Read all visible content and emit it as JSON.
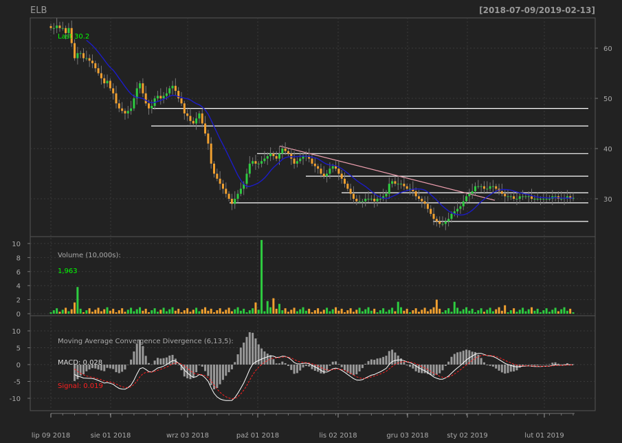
{
  "header": {
    "symbol": "ELB",
    "date_range": "[2018-07-09/2019-02-13]"
  },
  "price_panel": {
    "last_label": "Last 30.2",
    "y_ticks": [
      30,
      40,
      50,
      60
    ]
  },
  "volume_panel": {
    "title": "Volume (10,000s):",
    "value": "1,963",
    "y_ticks": [
      0,
      2,
      4,
      6,
      8,
      10
    ]
  },
  "macd_panel": {
    "title": "Moving Average Convergence Divergence (6,13,5):",
    "macd_label": "MACD: 0.028",
    "signal_label": "Signal: 0.019",
    "y_ticks": [
      -10,
      -5,
      0,
      5,
      10
    ]
  },
  "x_axis": {
    "labels": [
      "lip 09 2018",
      "sie 01 2018",
      "wrz 03 2018",
      "paź 01 2018",
      "lis 02 2018",
      "gru 03 2018",
      "sty 02 2019",
      "lut 01 2019"
    ]
  },
  "colors": {
    "background": "#222222",
    "up": "#2ecc40",
    "down": "#f0a030",
    "ma": "#1c1cc8",
    "trendline": "#f0a0b0",
    "hline": "#ffffff",
    "grid": "#3a3a3a",
    "text": "#aaaaaa",
    "green_text": "#00ff00",
    "macd_line": "#ffffff",
    "signal_line": "#ff2020",
    "hist": "#999999"
  },
  "chart_data": {
    "type": "candlestick",
    "dates_start": "2018-07-09",
    "dates_end": "2019-02-13",
    "close": [
      64,
      64,
      64.5,
      64,
      64,
      63,
      64,
      61,
      58,
      59,
      59,
      58,
      58,
      57.5,
      57,
      56,
      55,
      54,
      53,
      53.5,
      52,
      51,
      49,
      48,
      47.5,
      47,
      47.5,
      48,
      50,
      52,
      53,
      51,
      49,
      48,
      48.5,
      50,
      50.5,
      50,
      50.5,
      51,
      52,
      52.5,
      51.5,
      50,
      49,
      47,
      46.5,
      45.5,
      45,
      46,
      47,
      45,
      43,
      41,
      37,
      35,
      34,
      33,
      32,
      31,
      30,
      29,
      30,
      31,
      32,
      33,
      35,
      37,
      37.5,
      37,
      37,
      37.5,
      38,
      38.5,
      39,
      38.5,
      38,
      39,
      40,
      39.5,
      39,
      38,
      37,
      37.5,
      38,
      38.5,
      38.5,
      38,
      37,
      36.5,
      36,
      35,
      34.5,
      35,
      36,
      36.5,
      36,
      35,
      34,
      33,
      32,
      31,
      30,
      29.5,
      29.5,
      29.5,
      30,
      30,
      30,
      29.5,
      30,
      30,
      30.5,
      31,
      33,
      33.5,
      33,
      33,
      33,
      32.5,
      32,
      32,
      31.5,
      30.5,
      30,
      29.5,
      29,
      28,
      27,
      26,
      25.5,
      25,
      25,
      25.5,
      26,
      27,
      27.5,
      28,
      28.5,
      29.5,
      30.5,
      31,
      31.5,
      32.5,
      32.5,
      32.5,
      32,
      32,
      32.5,
      32.5,
      32,
      31.5,
      31,
      30.5,
      30.5,
      30.5,
      30,
      30,
      30.5,
      30.5,
      30.5,
      30.5,
      30,
      30,
      30,
      30,
      30,
      30,
      30,
      30.5,
      30.5,
      30,
      30,
      30.2,
      30.5,
      30,
      30.2
    ],
    "volume_max_10k": 10.5,
    "hlines": [
      48,
      44.5,
      39,
      34.5,
      31.2,
      29.2,
      25.5
    ],
    "macd_last": 0.028,
    "signal_last": 0.019,
    "last": 30.2,
    "volume_last": "1,963"
  }
}
